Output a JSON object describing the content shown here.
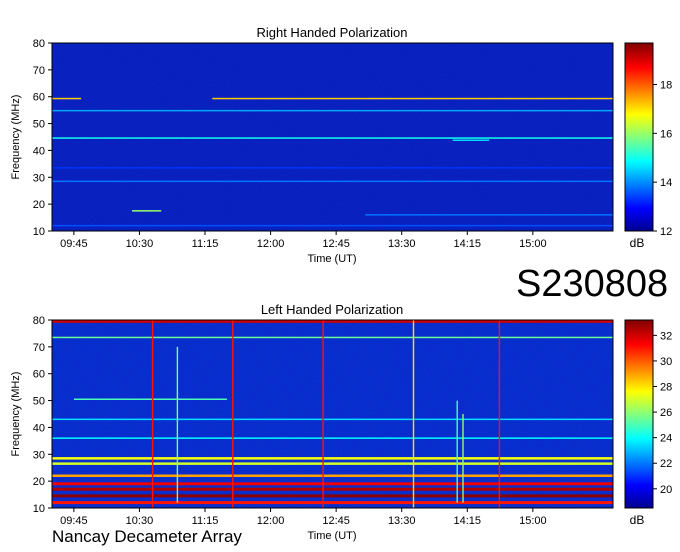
{
  "event_code": "S230808",
  "instrument": "Nancay Decameter Array",
  "chart_data": [
    {
      "type": "heatmap",
      "title": "Right Handed Polarization",
      "xlabel": "Time (UT)",
      "ylabel": "Frequency (MHz)",
      "x_ticks": [
        "09:45",
        "10:30",
        "11:15",
        "12:00",
        "12:45",
        "13:30",
        "14:15",
        "15:00"
      ],
      "y_ticks": [
        10,
        20,
        30,
        40,
        50,
        60,
        70,
        80
      ],
      "xlim": [
        "09:30",
        "15:55"
      ],
      "ylim": [
        10,
        80
      ],
      "colorbar": {
        "label": "dB",
        "ticks": [
          12,
          14,
          16,
          18
        ],
        "range": [
          12,
          19.7
        ]
      },
      "background_level": 12.8,
      "colors": {
        "low": "#00008f",
        "mid": "#00ffff",
        "high": "#ff0000",
        "max": "#800000"
      },
      "features": [
        {
          "kind": "band",
          "freq": 59.3,
          "t_start": "09:30",
          "t_end": "09:50",
          "level": 17.2
        },
        {
          "kind": "band",
          "freq": 59.3,
          "t_start": "11:20",
          "t_end": "15:55",
          "level": 17.2
        },
        {
          "kind": "band",
          "freq": 54.8,
          "t_start": "09:30",
          "t_end": "15:55",
          "level": 14.2
        },
        {
          "kind": "band",
          "freq": 44.6,
          "t_start": "09:30",
          "t_end": "15:55",
          "level": 15.0
        },
        {
          "kind": "band",
          "freq": 43.8,
          "t_start": "14:05",
          "t_end": "14:30",
          "level": 14.6
        },
        {
          "kind": "band",
          "freq": 28.5,
          "t_start": "09:30",
          "t_end": "15:55",
          "level": 13.8
        },
        {
          "kind": "band",
          "freq": 33.5,
          "t_start": "09:30",
          "t_end": "15:55",
          "level": 13.3
        },
        {
          "kind": "band",
          "freq": 17.5,
          "t_start": "10:25",
          "t_end": "10:45",
          "level": 16.0
        },
        {
          "kind": "band",
          "freq": 16.0,
          "t_start": "13:05",
          "t_end": "15:55",
          "level": 13.8
        },
        {
          "kind": "band",
          "freq": 12.0,
          "t_start": "09:30",
          "t_end": "15:55",
          "level": 13.5
        }
      ]
    },
    {
      "type": "heatmap",
      "title": "Left Handed Polarization",
      "xlabel": "Time (UT)",
      "ylabel": "Frequency (MHz)",
      "x_ticks": [
        "09:45",
        "10:30",
        "11:15",
        "12:00",
        "12:45",
        "13:30",
        "14:15",
        "15:00"
      ],
      "y_ticks": [
        10,
        20,
        30,
        40,
        50,
        60,
        70,
        80
      ],
      "xlim": [
        "09:30",
        "15:55"
      ],
      "ylim": [
        10,
        80
      ],
      "colorbar": {
        "label": "dB",
        "ticks": [
          20,
          22,
          24,
          26,
          28,
          30,
          32
        ],
        "range": [
          18.5,
          33.2
        ]
      },
      "background_level": 20.5,
      "colors": {
        "low": "#00008f",
        "mid": "#00ffff",
        "high": "#ff0000",
        "max": "#800000"
      },
      "features": [
        {
          "kind": "band",
          "freq": 79.5,
          "t_start": "09:30",
          "t_end": "15:55",
          "level": 32.0
        },
        {
          "kind": "band",
          "freq": 73.5,
          "t_start": "09:30",
          "t_end": "15:55",
          "level": 25.5
        },
        {
          "kind": "band",
          "freq": 50.5,
          "t_start": "09:45",
          "t_end": "11:30",
          "level": 25.0
        },
        {
          "kind": "band",
          "freq": 43.0,
          "t_start": "09:30",
          "t_end": "15:55",
          "level": 23.5
        },
        {
          "kind": "band",
          "freq": 36.0,
          "t_start": "09:30",
          "t_end": "15:55",
          "level": 24.0
        },
        {
          "kind": "band",
          "freq": 28.5,
          "t_start": "09:30",
          "t_end": "15:55",
          "level": 27.5
        },
        {
          "kind": "band",
          "freq": 26.5,
          "t_start": "09:30",
          "t_end": "15:55",
          "level": 27.0
        },
        {
          "kind": "band",
          "freq": 22.0,
          "t_start": "09:30",
          "t_end": "15:55",
          "level": 29.0
        },
        {
          "kind": "band",
          "freq": 19.0,
          "t_start": "09:30",
          "t_end": "15:55",
          "level": 31.5
        },
        {
          "kind": "band",
          "freq": 17.0,
          "t_start": "09:30",
          "t_end": "15:55",
          "level": 32.5
        },
        {
          "kind": "band",
          "freq": 14.5,
          "t_start": "09:30",
          "t_end": "15:55",
          "level": 33.0
        },
        {
          "kind": "band",
          "freq": 12.0,
          "t_start": "09:30",
          "t_end": "15:55",
          "level": 31.0
        },
        {
          "kind": "burst",
          "time": "10:39",
          "f_low": 10,
          "f_high": 80,
          "level": 31.0
        },
        {
          "kind": "burst",
          "time": "11:34",
          "f_low": 10,
          "f_high": 80,
          "level": 31.0
        },
        {
          "kind": "burst",
          "time": "12:36",
          "f_low": 10,
          "f_high": 80,
          "level": 31.0
        },
        {
          "kind": "burst",
          "time": "13:38",
          "f_low": 10,
          "f_high": 80,
          "level": 28.0
        },
        {
          "kind": "burst",
          "time": "14:37",
          "f_low": 10,
          "f_high": 80,
          "level": 31.0
        },
        {
          "kind": "burst",
          "time": "10:56",
          "f_low": 12,
          "f_high": 70,
          "level": 26.0
        },
        {
          "kind": "burst",
          "time": "14:08",
          "f_low": 12,
          "f_high": 50,
          "level": 25.0
        },
        {
          "kind": "burst",
          "time": "14:12",
          "f_low": 12,
          "f_high": 45,
          "level": 26.0
        }
      ]
    }
  ]
}
